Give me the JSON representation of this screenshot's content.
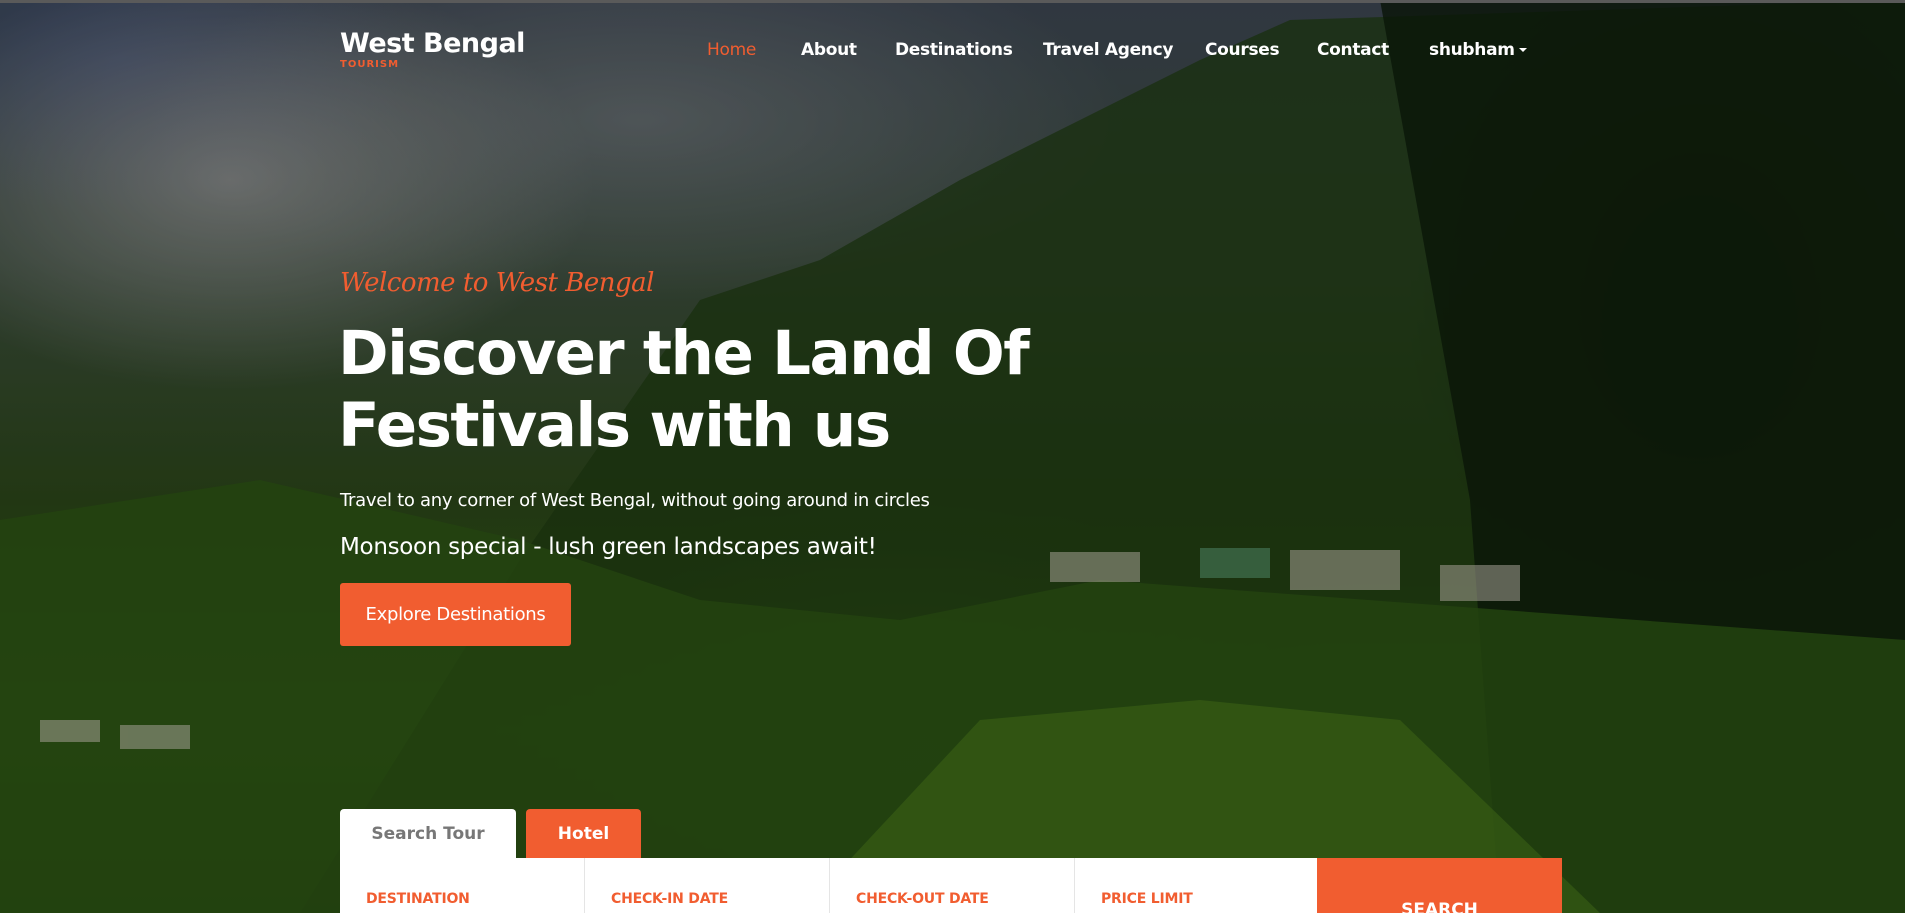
{
  "brand": {
    "name": "West Bengal",
    "sub": "TOURISM"
  },
  "nav": {
    "items": [
      {
        "label": "Home",
        "active": true
      },
      {
        "label": "About"
      },
      {
        "label": "Destinations"
      },
      {
        "label": "Travel Agency"
      },
      {
        "label": "Courses"
      },
      {
        "label": "Contact"
      },
      {
        "label": "shubham",
        "dropdown": true
      }
    ]
  },
  "hero": {
    "welcome": "Welcome to West Bengal",
    "headline_line1": "Discover the Land Of",
    "headline_line2": "Festivals with us",
    "tagline": "Travel to any corner of West Bengal, without going around in circles",
    "promo": "Monsoon special - lush green landscapes await!",
    "cta": "Explore Destinations"
  },
  "search": {
    "tabs": [
      "Search Tour",
      "Hotel"
    ],
    "active_tab": "Search Tour",
    "fields": [
      "DESTINATION",
      "CHECK-IN DATE",
      "CHECK-OUT DATE",
      "PRICE LIMIT"
    ],
    "button": "SEARCH"
  },
  "colors": {
    "accent": "#f15d30",
    "text_on_dark": "#ffffff"
  },
  "icons": {
    "dropdown": "caret-down-icon"
  }
}
